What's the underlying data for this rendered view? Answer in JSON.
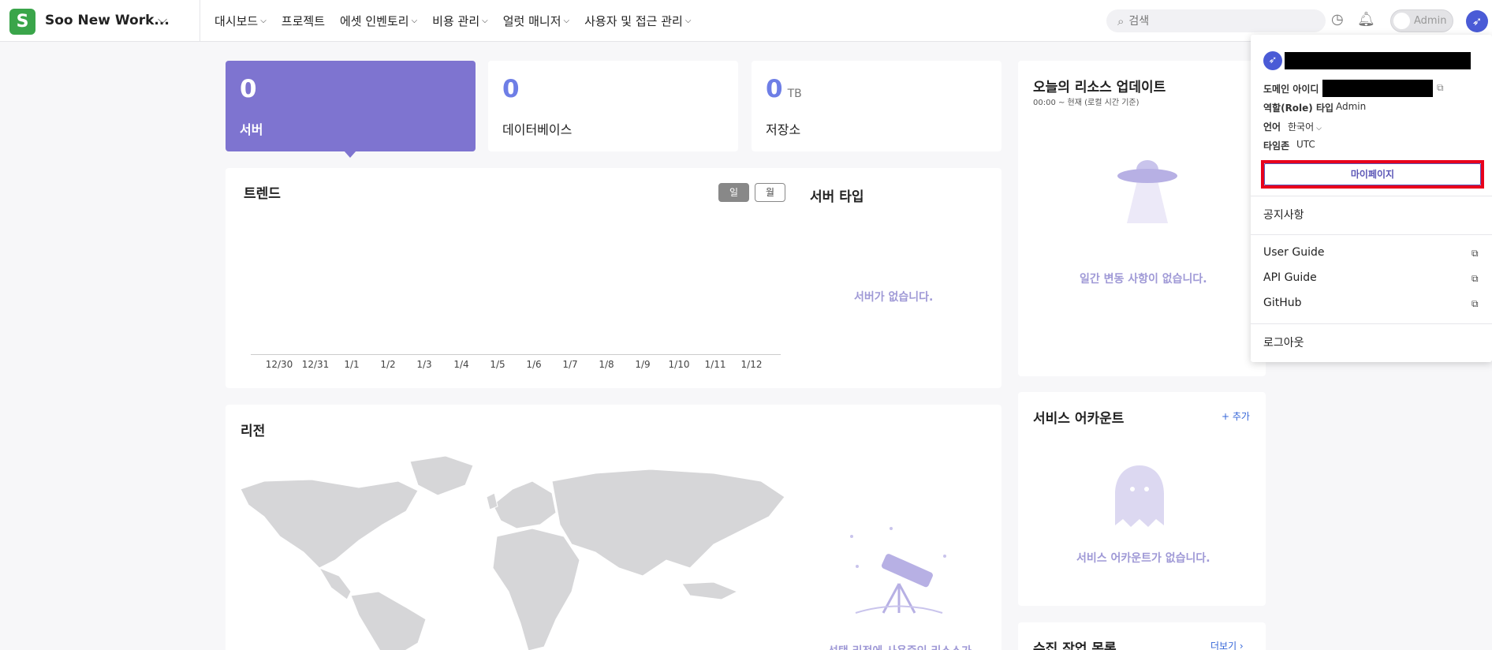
{
  "header": {
    "workspace_initial": "S",
    "workspace_name": "Soo New Work...",
    "nav": [
      {
        "label": "대시보드"
      },
      {
        "label": "프로젝트"
      },
      {
        "label": "에셋 인벤토리"
      },
      {
        "label": "비용 관리"
      },
      {
        "label": "얼럿 매니저"
      },
      {
        "label": "사용자 및 접근 관리"
      }
    ],
    "search_placeholder": "검색",
    "admin_label": "Admin"
  },
  "stats": [
    {
      "value": "0",
      "unit": "",
      "label": "서버"
    },
    {
      "value": "0",
      "unit": "",
      "label": "데이터베이스"
    },
    {
      "value": "0",
      "unit": "TB",
      "label": "저장소"
    }
  ],
  "trend": {
    "title": "트렌드",
    "day_label": "일",
    "month_label": "월",
    "x_ticks": [
      "12/30",
      "12/31",
      "1/1",
      "1/2",
      "1/3",
      "1/4",
      "1/5",
      "1/6",
      "1/7",
      "1/8",
      "1/9",
      "1/10",
      "1/11",
      "1/12"
    ]
  },
  "server_type": {
    "title": "서버 타입",
    "empty": "서버가 없습니다."
  },
  "region": {
    "title": "리전",
    "empty": "선택 리전에 사용중인 리소스가"
  },
  "updates": {
    "title": "오늘의 리소스 업데이트",
    "subtitle": "00:00 ~ 현재 (로컬 시간 기준)",
    "empty": "일간 변동 사항이 없습니다."
  },
  "service_accounts": {
    "title": "서비스 어카운트",
    "add_label": "+ 추가",
    "empty": "서비스 어카운트가 없습니다."
  },
  "collect_jobs": {
    "title": "수집 작업 목록",
    "more_label": "더보기 ›"
  },
  "dropdown": {
    "domain_id_label": "도메인 아이디",
    "role_label": "역할(Role) 타입",
    "role_value": "Admin",
    "language_label": "언어",
    "language_value": "한국어",
    "timezone_label": "타임존",
    "timezone_value": "UTC",
    "mypage_label": "마이페이지",
    "notice_label": "공지사항",
    "user_guide_label": "User Guide",
    "api_guide_label": "API Guide",
    "github_label": "GitHub",
    "logout_label": "로그아웃"
  }
}
